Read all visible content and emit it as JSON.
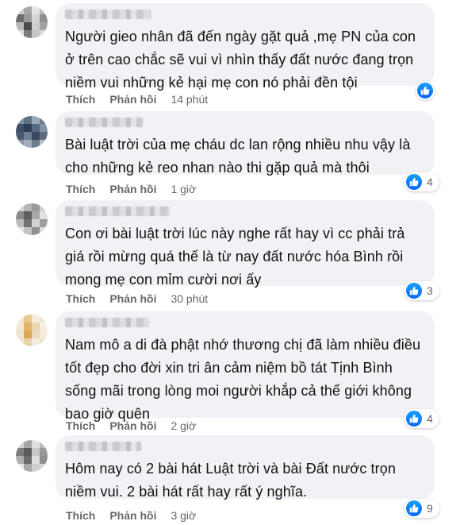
{
  "colors": {
    "bubble": "#f0f2f5",
    "meta_text": "#65676b",
    "like_blue": "#0866ff"
  },
  "comments": [
    {
      "text": "Người gieo nhân đã đến ngày gặt quả ,mẹ PN của con\nở trên cao chắc sẽ vui vì nhìn thấy đất nước đang trọn\nniềm vui những kẻ hại mẹ con nó phải đền tội",
      "like_label": "Thích",
      "reply_label": "Phản hồi",
      "time": "14 phút",
      "reaction_icon": "like-icon",
      "reaction_count": ""
    },
    {
      "text": "Bài luật trời của mẹ cháu dc lan rộng nhiều nhu vậy là\ncho những kẻ reo nhan nào thi gặp quả mà thôi",
      "like_label": "Thích",
      "reply_label": "Phản hồi",
      "time": "1 giờ",
      "reaction_icon": "like-icon",
      "reaction_count": "4"
    },
    {
      "text": "Con ơi bài luật trời lúc này nghe rất hay vì cc phải trả\ngiá rồi mừng quá thế là từ nay đất nước hóa Bình rồi\nmong mẹ con mỉm cười nơi ấy",
      "like_label": "Thích",
      "reply_label": "Phản hồi",
      "time": "30 phút",
      "reaction_icon": "like-icon",
      "reaction_count": "3"
    },
    {
      "text": "Nam mô a di đà phật nhớ thương chị đã làm nhiều điều\ntốt đẹp cho đời xin tri ân cảm niệm bồ tát Tịnh Bình\nsống mãi trong lòng moi người khắp cả thế giới không\nbao giờ quên",
      "like_label": "Thích",
      "reply_label": "Phản hồi",
      "time": "2 giờ",
      "reaction_icon": "like-icon",
      "reaction_count": "4"
    },
    {
      "text": "Hôm nay có 2 bài hát Luật trời và bài Đất nước trọn\nniềm vui. 2 bài hát rất hay rất ý nghĩa.",
      "like_label": "Thích",
      "reply_label": "Phản hồi",
      "time": "3 giờ",
      "reaction_icon": "like-icon",
      "reaction_count": "9"
    }
  ]
}
